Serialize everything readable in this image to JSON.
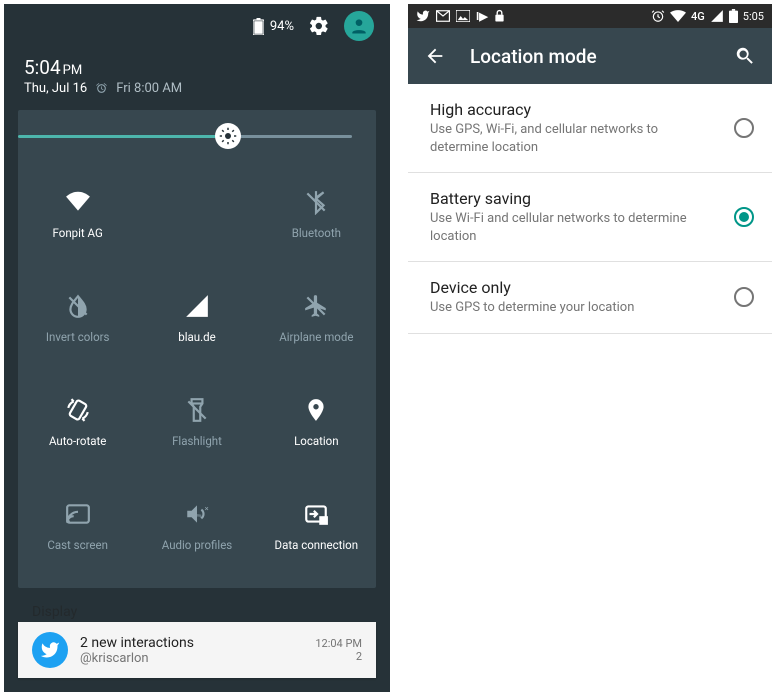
{
  "left": {
    "statusbar": {
      "battery_pct": "94%"
    },
    "clock": {
      "time": "5:04",
      "ampm": "PM",
      "date": "Thu, Jul 16",
      "alarm": "Fri 8:00 AM"
    },
    "brightness_pct": 60,
    "tiles": [
      {
        "name": "wifi",
        "label": "Fonpit AG",
        "active": true
      },
      {
        "name": "bluetooth",
        "label": "Bluetooth",
        "active": false
      },
      {
        "name": "invert-colors",
        "label": "Invert colors",
        "active": false
      },
      {
        "name": "signal",
        "label": "blau.de",
        "active": true
      },
      {
        "name": "airplane",
        "label": "Airplane mode",
        "active": false
      },
      {
        "name": "auto-rotate",
        "label": "Auto-rotate",
        "active": true
      },
      {
        "name": "flashlight",
        "label": "Flashlight",
        "active": false
      },
      {
        "name": "location",
        "label": "Location",
        "active": true
      },
      {
        "name": "cast",
        "label": "Cast screen",
        "active": false
      },
      {
        "name": "audio",
        "label": "Audio profiles",
        "active": false
      },
      {
        "name": "data",
        "label": "Data connection",
        "active": true
      }
    ],
    "row4_col": [
      0,
      1,
      2
    ],
    "bg_item": "Display",
    "notification": {
      "title": "2 new interactions",
      "subtitle": "@kriscarlon",
      "time": "12:04 PM",
      "count": "2"
    }
  },
  "right": {
    "statusbar": {
      "network": "4G",
      "time": "5:05"
    },
    "title": "Location mode",
    "options": [
      {
        "title": "High accuracy",
        "sub": "Use GPS, Wi-Fi, and cellular networks to determine location",
        "selected": false
      },
      {
        "title": "Battery saving",
        "sub": "Use Wi-Fi and cellular networks to determine location",
        "selected": true
      },
      {
        "title": "Device only",
        "sub": "Use GPS to determine your location",
        "selected": false
      }
    ]
  }
}
